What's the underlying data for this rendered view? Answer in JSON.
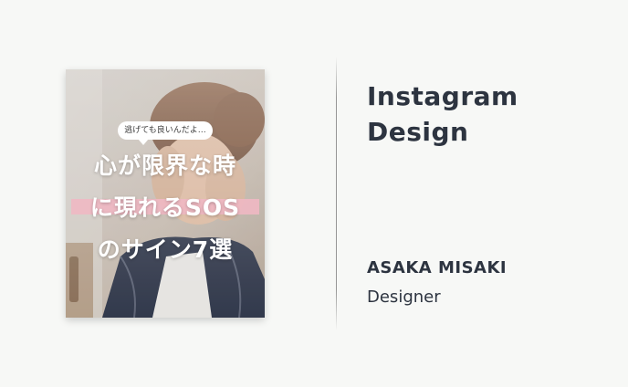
{
  "card": {
    "bubble_text": "逃げても良いんだよ…",
    "headline_line1": "心が限界な時",
    "headline_line2": "に現れるSOS",
    "headline_line3": "のサイン7選"
  },
  "info": {
    "title_line1": "Instagram",
    "title_line2": "Design",
    "name": "ASAKA MISAKI",
    "role": "Designer"
  },
  "colors": {
    "background": "#f7f8f6",
    "text": "#2d3440",
    "highlight": "#efb8c3"
  }
}
